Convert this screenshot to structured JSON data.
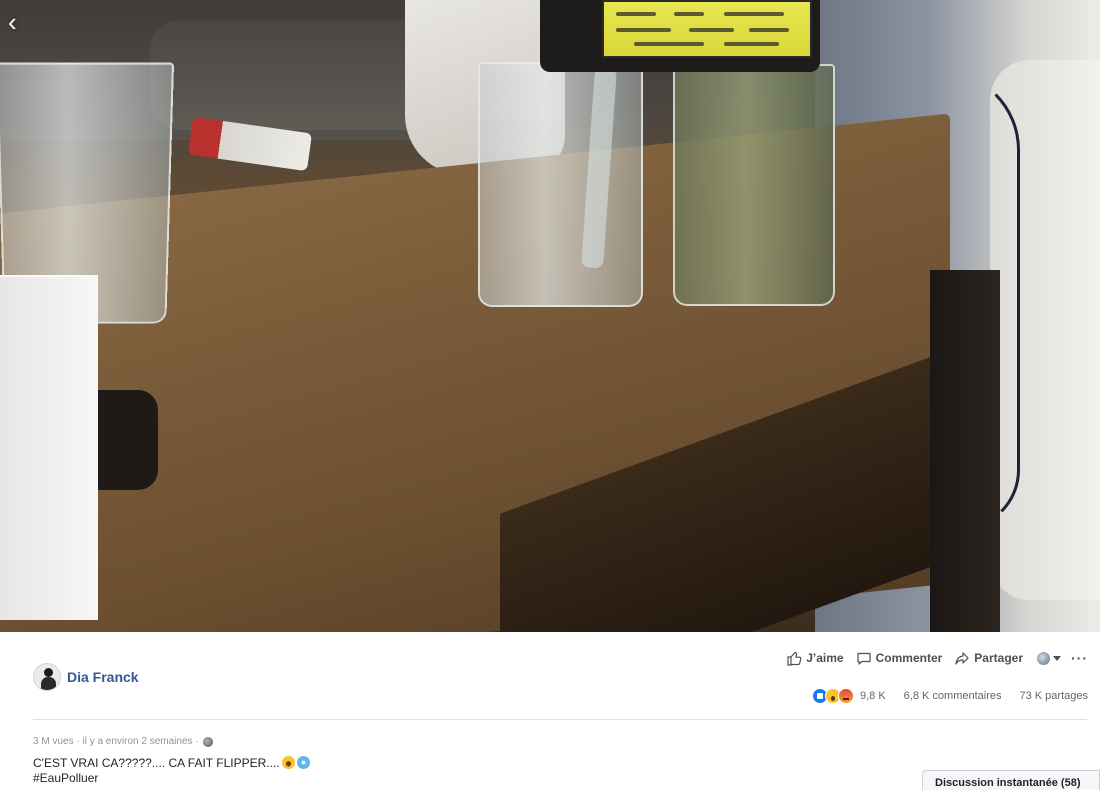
{
  "video": {
    "back_icon": "chevron-left-icon"
  },
  "author": {
    "name": "Dia Franck"
  },
  "actions": {
    "like_label": "J’aime",
    "comment_label": "Commenter",
    "share_label": "Partager",
    "more_label": "···"
  },
  "stats": {
    "reactions": [
      "like",
      "wow",
      "angry"
    ],
    "reaction_count": "9,8 K",
    "comments": "6,8 K commentaires",
    "shares": "73 K partages"
  },
  "meta": {
    "views": "3 M vues",
    "time": "il y a environ 2 semaines"
  },
  "post": {
    "text": "C'EST VRAI CA?????.... CA FAIT FLIPPER....",
    "hashtag": "#EauPolluer"
  },
  "chat": {
    "label": "Discussion instantanée (58)"
  },
  "colors": {
    "link_blue": "#365899",
    "like_blue": "#1877f2",
    "text": "#1d2129",
    "muted": "#90949c"
  }
}
